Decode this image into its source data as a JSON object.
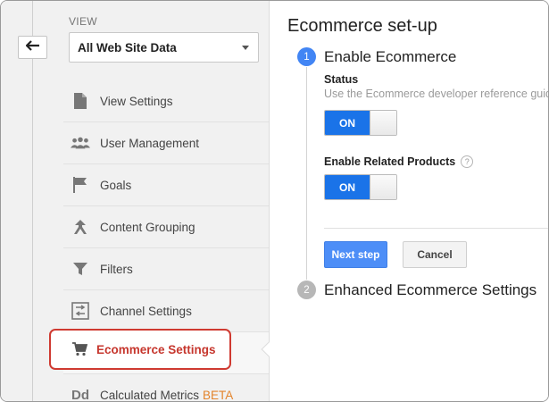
{
  "left": {
    "view_label": "VIEW",
    "view_select": "All Web Site Data",
    "back_icon": "back-arrow-icon",
    "nav": [
      {
        "label": "View Settings",
        "icon": "document-icon"
      },
      {
        "label": "User Management",
        "icon": "users-icon"
      },
      {
        "label": "Goals",
        "icon": "flag-icon"
      },
      {
        "label": "Content Grouping",
        "icon": "merge-arrow-icon"
      },
      {
        "label": "Filters",
        "icon": "filter-icon"
      },
      {
        "label": "Channel Settings",
        "icon": "channel-icon"
      },
      {
        "label": "Ecommerce Settings",
        "icon": "cart-icon",
        "active": true
      },
      {
        "label": "Calculated Metrics",
        "icon": "dd-icon",
        "badge": "BETA"
      }
    ]
  },
  "main": {
    "title": "Ecommerce set-up",
    "step1": {
      "number": "1",
      "title": "Enable Ecommerce",
      "status_label": "Status",
      "status_help": "Use the Ecommerce developer reference guide",
      "status_toggle": "ON",
      "related_label": "Enable Related Products",
      "related_help_icon": "?",
      "related_toggle": "ON",
      "next_button": "Next step",
      "cancel_button": "Cancel"
    },
    "step2": {
      "number": "2",
      "title": "Enhanced Ecommerce Settings"
    }
  },
  "colors": {
    "accent_blue": "#1a73e8",
    "highlight_red": "#cf3a31",
    "beta_orange": "#e3842d"
  }
}
